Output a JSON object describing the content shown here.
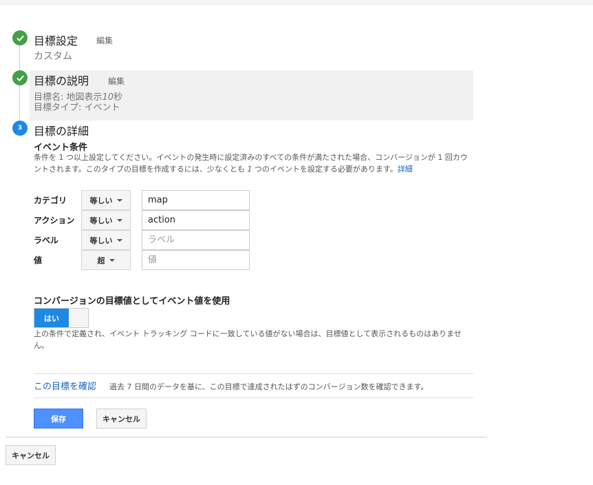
{
  "step1": {
    "title": "目標設定",
    "edit": "編集",
    "value": "カスタム"
  },
  "step2": {
    "title": "目標の説明",
    "edit": "編集",
    "name_prefix": "目標名: 地図表示",
    "name_em": "10",
    "name_suffix": "秒",
    "type_line": "目標タイプ: イベント"
  },
  "step3": {
    "number": "3",
    "title": "目標の詳細",
    "section_title": "イベント条件",
    "desc_a": "条件を 1 つ以上設定してください。イベントの発生時に設定済みのすべての条件が満たされた場合、コンバージョンが 1 回カウントされます。このタイプの目標を作成するには、少なくとも ",
    "desc_em": "1",
    "desc_b": " つのイベントを設定する必要があります。",
    "details_link": "詳細"
  },
  "conditions": [
    {
      "label": "カテゴリ",
      "operator": "等しい",
      "value": "map",
      "placeholder": ""
    },
    {
      "label": "アクション",
      "operator": "等しい",
      "value": "action",
      "placeholder": ""
    },
    {
      "label": "ラベル",
      "operator": "等しい",
      "value": "",
      "placeholder": "ラベル"
    },
    {
      "label": "値",
      "operator": "超",
      "value": "",
      "placeholder": "値"
    }
  ],
  "conversion": {
    "title": "コンバージョンの目標値としてイベント値を使用",
    "toggle_on": "はい",
    "desc": "上の条件で定義され、イベント トラッキング コードに一致している値がない場合は、目標値として表示されるものはありません。"
  },
  "verify": {
    "link": "この目標を確認",
    "desc": "過去 7 日間のデータを基に、この目標で達成されたはずのコンバージョン数を確認できます。"
  },
  "buttons": {
    "save": "保存",
    "cancel": "キャンセル",
    "outer_cancel": "キャンセル"
  },
  "colors": {
    "done": "#43a047",
    "current": "#1e88e5",
    "primary": "#4d90fe",
    "link": "#1565c0"
  }
}
